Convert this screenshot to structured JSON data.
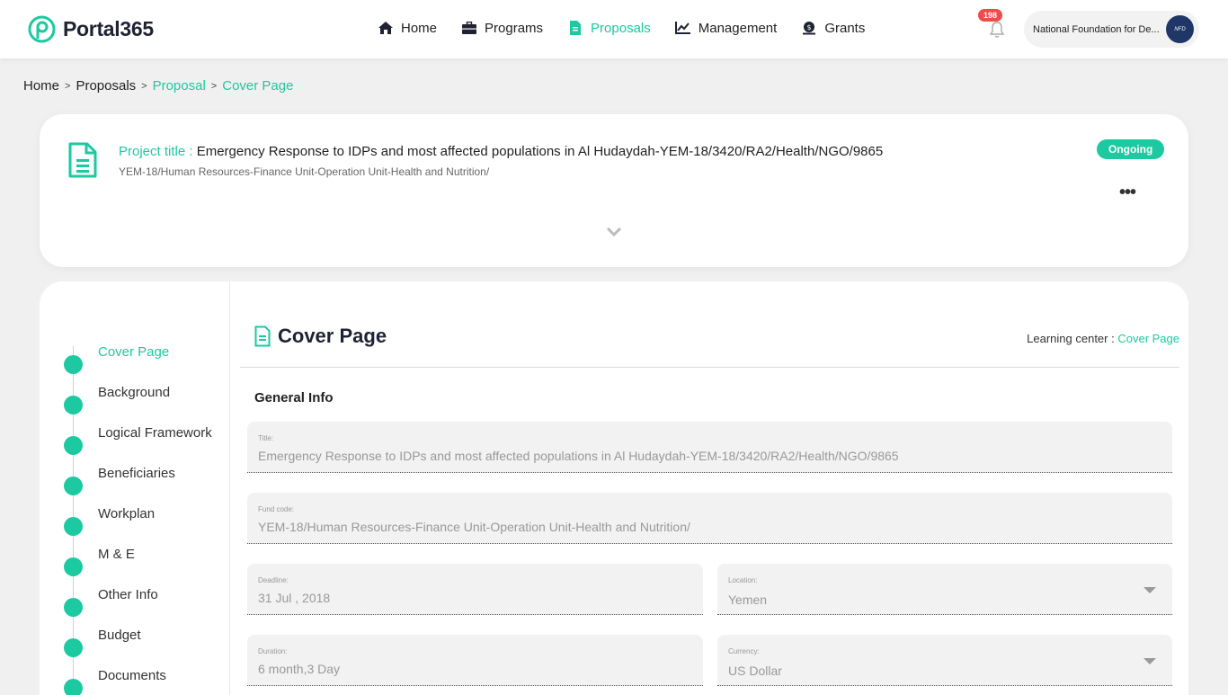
{
  "brand": {
    "name": "Portal365",
    "color": "#1cc9a0"
  },
  "nav": {
    "items": [
      {
        "label": "Home",
        "icon": "home-icon"
      },
      {
        "label": "Programs",
        "icon": "briefcase-icon"
      },
      {
        "label": "Proposals",
        "icon": "document-icon",
        "active": true
      },
      {
        "label": "Management",
        "icon": "chart-line-icon"
      },
      {
        "label": "Grants",
        "icon": "money-icon"
      }
    ]
  },
  "notifications": {
    "count": "198",
    "icon": "bell-icon"
  },
  "account": {
    "name": "National Foundation for De...",
    "avatar_text": "NFD"
  },
  "breadcrumb": {
    "items": [
      "Home",
      "Proposals",
      "Proposal",
      "Cover Page"
    ],
    "separator": ">"
  },
  "project": {
    "title_label": "Project title :",
    "title": " Emergency Response to IDPs and most affected populations in Al Hudaydah-YEM-18/3420/RA2/Health/NGO/9865",
    "subtitle": "YEM-18/Human Resources-Finance Unit-Operation Unit-Health and Nutrition/",
    "status": "Ongoing",
    "more": "•••"
  },
  "steps": [
    {
      "label": "Cover Page",
      "active": true
    },
    {
      "label": "Background"
    },
    {
      "label": "Logical Framework"
    },
    {
      "label": "Beneficiaries"
    },
    {
      "label": "Workplan"
    },
    {
      "label": "M & E"
    },
    {
      "label": "Other Info"
    },
    {
      "label": "Budget"
    },
    {
      "label": "Documents"
    }
  ],
  "section": {
    "title": "Cover Page",
    "learning_label": "Learning center : ",
    "learning_link": "Cover Page",
    "subhead": "General Info"
  },
  "form": {
    "title": {
      "label": "Title:",
      "value": "Emergency Response to IDPs and most affected populations in Al Hudaydah-YEM-18/3420/RA2/Health/NGO/9865"
    },
    "fund_code": {
      "label": "Fund code:",
      "value": "YEM-18/Human Resources-Finance Unit-Operation Unit-Health and Nutrition/"
    },
    "deadline": {
      "label": "Deadline:",
      "value": "31 Jul , 2018"
    },
    "location": {
      "label": "Location:",
      "value": "Yemen"
    },
    "duration": {
      "label": "Duration:",
      "value": "6 month,3 Day"
    },
    "currency": {
      "label": "Currency:",
      "value": "US Dollar"
    }
  }
}
